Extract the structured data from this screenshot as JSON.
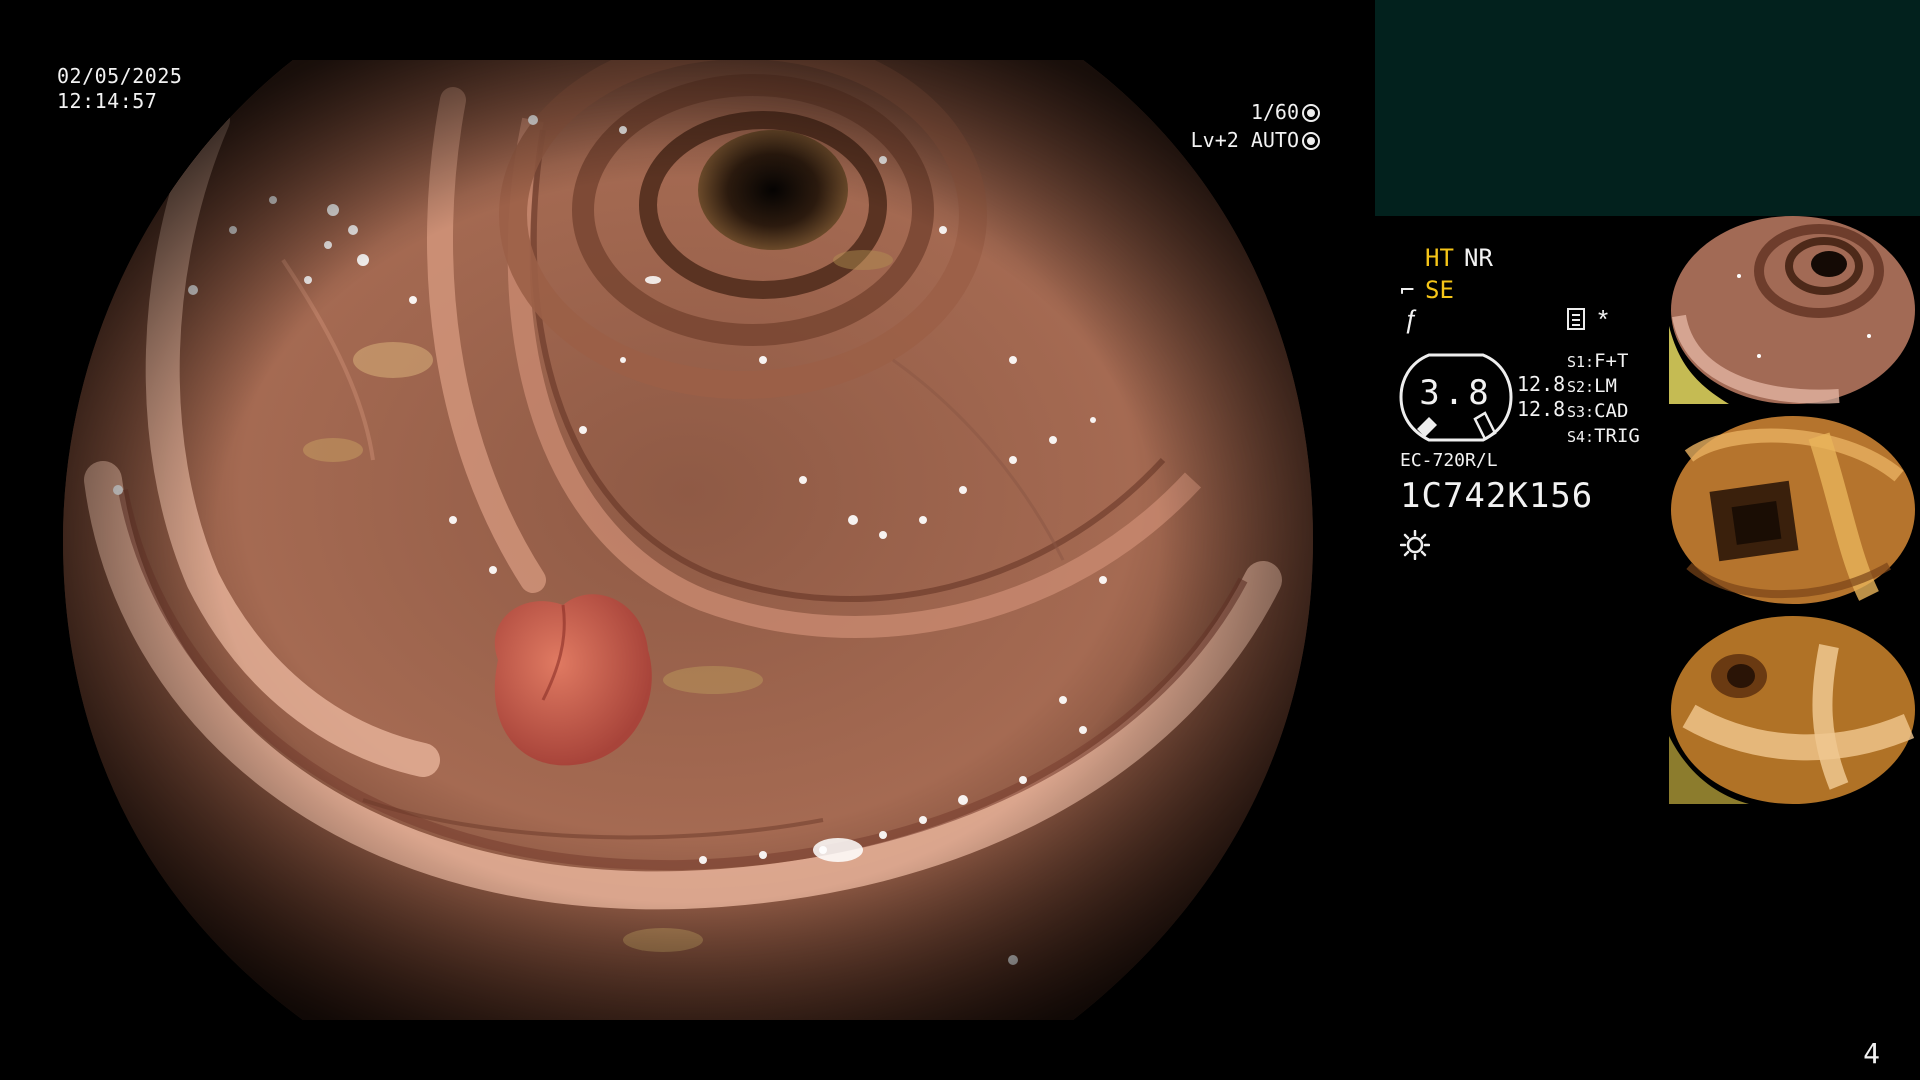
{
  "overlay": {
    "date": "02/05/2025",
    "time": "12:14:57",
    "shutter": "1/60",
    "level": "Lv+2 AUTO"
  },
  "status": {
    "ht": "HT",
    "nr": "NR",
    "se": "SE",
    "zoom": "3.8",
    "side_value_1": "12.8",
    "side_value_2": "12.8",
    "switches": [
      {
        "key": "S1:",
        "value": "F+T"
      },
      {
        "key": "S2:",
        "value": "LM"
      },
      {
        "key": "S3:",
        "value": "CAD"
      },
      {
        "key": "S4:",
        "value": "TRIG"
      }
    ],
    "scope_model": "EC-720R/L",
    "scope_serial": "1C742K156"
  },
  "colors": {
    "accent_yellow": "#f5c518",
    "panel_teal": "#02211d",
    "mucosa": "#a86a50"
  },
  "icons": [
    "shutter-icon",
    "auto-exposure-icon",
    "structure-enhance-icon",
    "function-icon",
    "memo-icon",
    "asterisk-icon",
    "light-icon"
  ],
  "thumbnails": [
    {
      "name": "thumbnail-1"
    },
    {
      "name": "thumbnail-2"
    },
    {
      "name": "thumbnail-3"
    }
  ],
  "page_number": "4"
}
